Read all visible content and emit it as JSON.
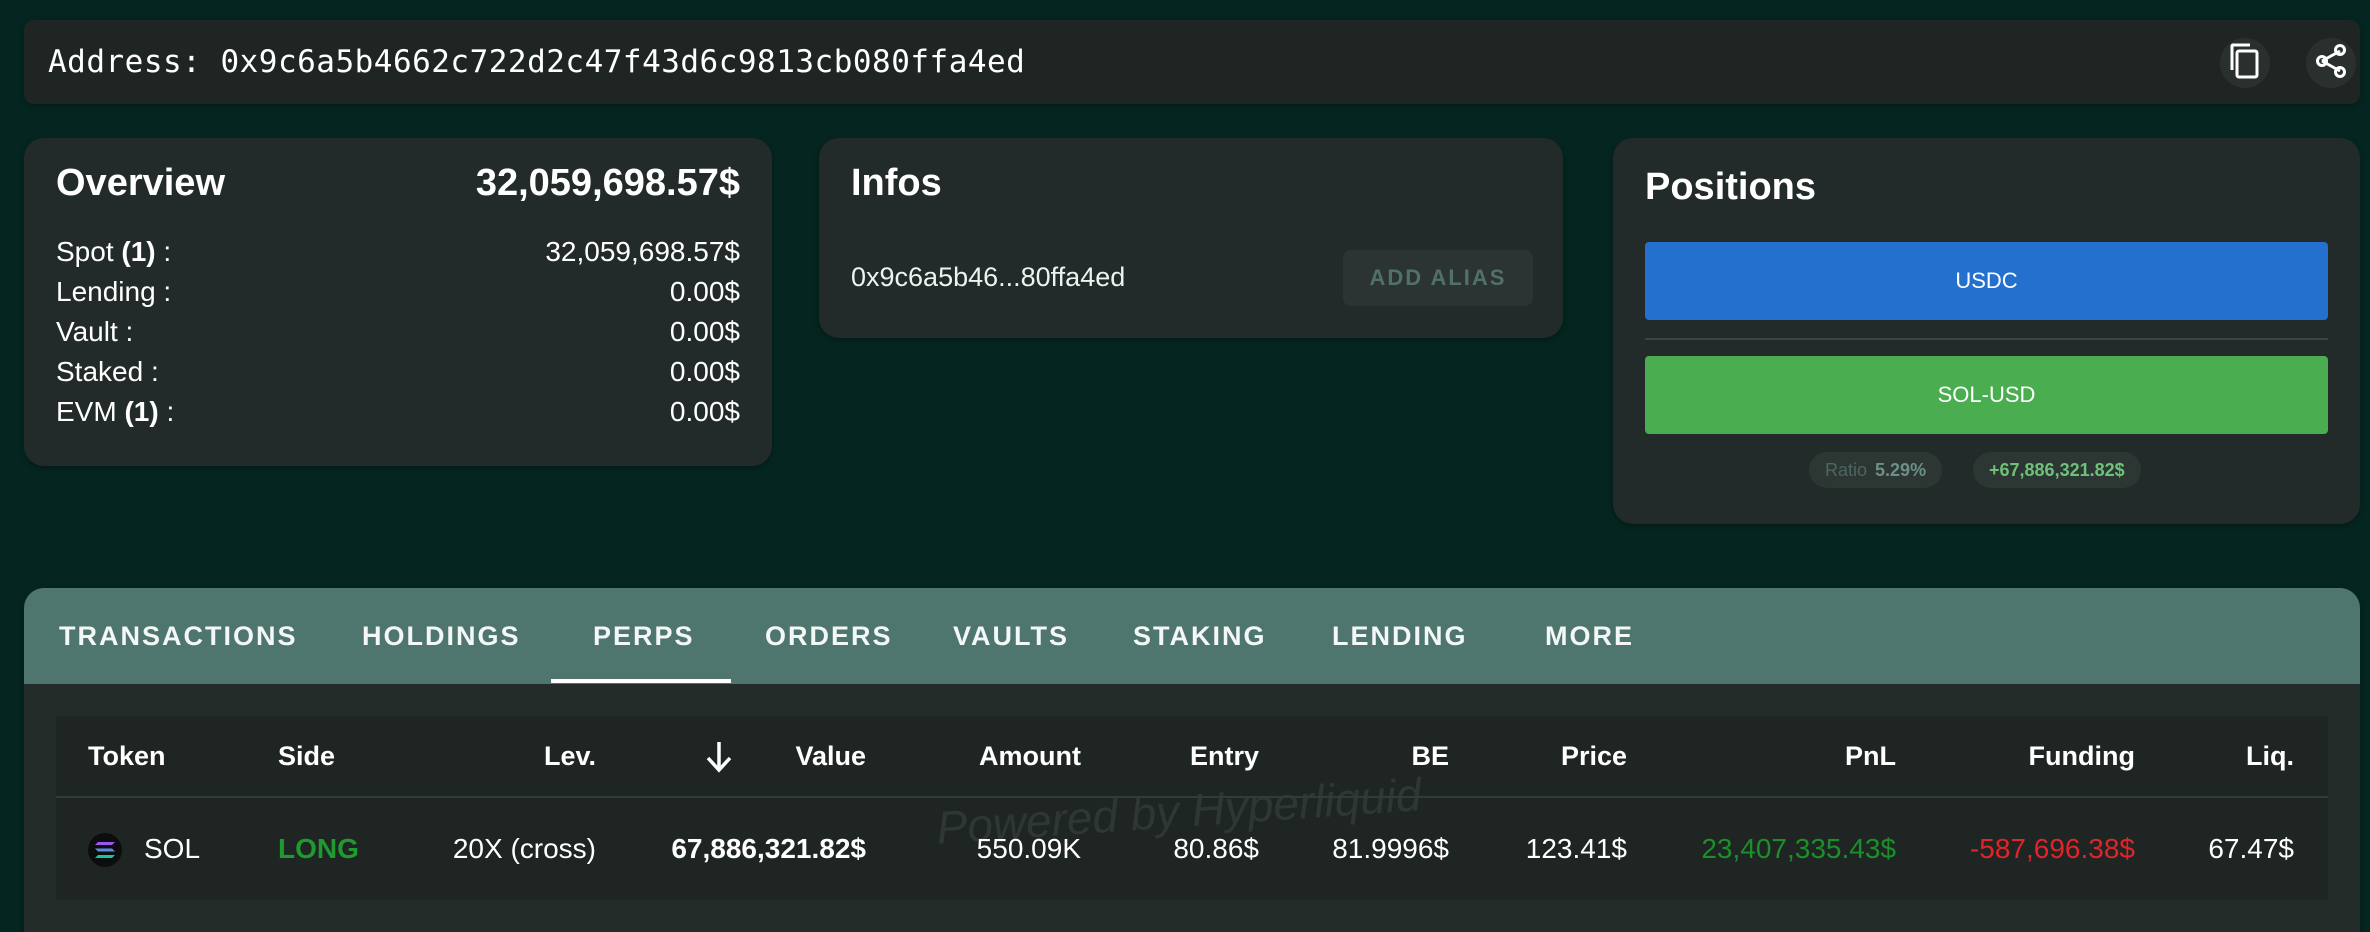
{
  "address_bar": {
    "label": "Address: 0x9c6a5b4662c722d2c47f43d6c9813cb080ffa4ed"
  },
  "overview": {
    "title": "Overview",
    "total": "32,059,698.57$",
    "rows": [
      {
        "label": "Spot ",
        "count": "(1)",
        "suffix": " :",
        "value": "32,059,698.57$"
      },
      {
        "label": "Lending :",
        "count": "",
        "suffix": "",
        "value": "0.00$"
      },
      {
        "label": "Vault :",
        "count": "",
        "suffix": "",
        "value": "0.00$"
      },
      {
        "label": "Staked :",
        "count": "",
        "suffix": "",
        "value": "0.00$"
      },
      {
        "label": "EVM ",
        "count": "(1)",
        "suffix": " :",
        "value": "0.00$"
      }
    ]
  },
  "infos": {
    "title": "Infos",
    "short_address": "0x9c6a5b46...80ffa4ed",
    "add_alias_label": "ADD ALIAS"
  },
  "positions": {
    "title": "Positions",
    "usdc_label": "USDC",
    "sol_label": "SOL-USD",
    "ratio_label": "Ratio",
    "ratio_value": "5.29%",
    "pnl_value": "+67,886,321.82$",
    "colors": {
      "usdc": "#2470cf",
      "sol": "#4aae50"
    }
  },
  "tabs": [
    {
      "label": "TRANSACTIONS"
    },
    {
      "label": "HOLDINGS"
    },
    {
      "label": "PERPS"
    },
    {
      "label": "ORDERS"
    },
    {
      "label": "VAULTS"
    },
    {
      "label": "STAKING"
    },
    {
      "label": "LENDING"
    },
    {
      "label": "MORE"
    }
  ],
  "active_tab": "PERPS",
  "table": {
    "headers": {
      "token": "Token",
      "side": "Side",
      "lev": "Lev.",
      "value": "Value",
      "amount": "Amount",
      "entry": "Entry",
      "be": "BE",
      "price": "Price",
      "pnl": "PnL",
      "funding": "Funding",
      "liq": "Liq."
    },
    "sort_icon": "arrow-down-icon",
    "rows": [
      {
        "token": "SOL",
        "side": "LONG",
        "lev": "20X (cross)",
        "value": "67,886,321.82$",
        "amount": "550.09K",
        "entry": "80.86$",
        "be": "81.9996$",
        "price": "123.41$",
        "pnl": "23,407,335.43$",
        "funding": "-587,696.38$",
        "liq": "67.47$"
      }
    ],
    "watermark": "Powered by Hyperliquid",
    "colors": {
      "long": "#1f9a2f",
      "pnl_positive": "#1c8f2a",
      "funding_negative": "#e0242a"
    }
  }
}
